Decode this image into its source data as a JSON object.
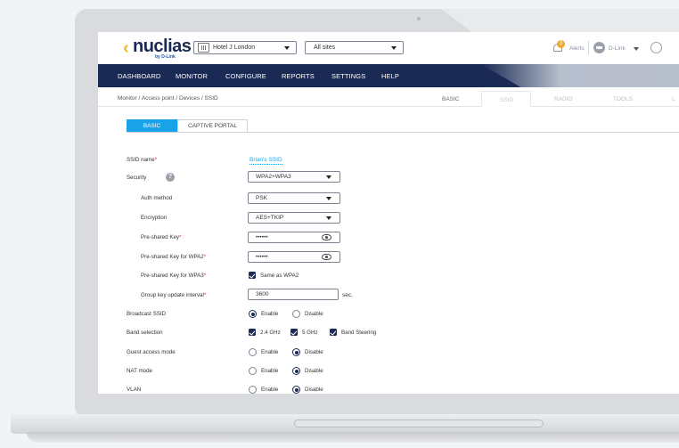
{
  "header": {
    "logo_text": "nuclias",
    "logo_sub": "by D-Link",
    "site_select": "Hotel J London",
    "scope_select": "All sites",
    "alerts_badge": "3",
    "alerts_label": "Alerts",
    "user_label": "D-Link"
  },
  "nav": {
    "items": [
      "DASHBOARD",
      "MONITOR",
      "CONFIGURE",
      "REPORTS",
      "SETTINGS",
      "HELP"
    ]
  },
  "breadcrumb": "Monitor  /  Access point  /  Devices  /  SSID",
  "top_tabs": {
    "basic": "BASIC",
    "ssid": "SSID",
    "radio": "RADIO",
    "tools": "TOOLS",
    "more": "L"
  },
  "content_tabs": {
    "basic": "BASIC",
    "captive": "CAPTIVE PORTAL"
  },
  "form": {
    "ssid_name_label": "SSID name",
    "ssid_name_value": "Brian's SSID",
    "security_label": "Security",
    "security_value": "WPA2+WPA3",
    "help_icon": "?",
    "auth_label": "Auth method",
    "auth_value": "PSK",
    "encryption_label": "Encryption",
    "encryption_value": "AES+TKIP",
    "psk_label": "Pre-shared Key",
    "psk_value": "••••••",
    "psk_wpa2_label": "Pre-shared Key for WPA2",
    "psk_wpa2_value": "••••••",
    "psk_wpa3_label": "Pre-shared Key for WPA3",
    "same_as_wpa2": "Same as WPA2",
    "group_key_label": "Group key update interval",
    "group_key_value": "3600",
    "group_key_unit": "sec.",
    "broadcast_label": "Broadcast SSID",
    "band_label": "Band selection",
    "band_24": "2.4 GHz",
    "band_5": "5 GHz",
    "band_steering": "Band Steering",
    "guest_label": "Guest access mode",
    "nat_label": "NAT mode",
    "vlan_label": "VLAN",
    "enable": "Enable",
    "disable": "Disable",
    "required_mark": "*"
  },
  "colors": {
    "nav_bg": "#1a2a54",
    "accent": "#1aa3e8",
    "required": "#e2232a",
    "brand_yellow": "#f1b71c"
  }
}
